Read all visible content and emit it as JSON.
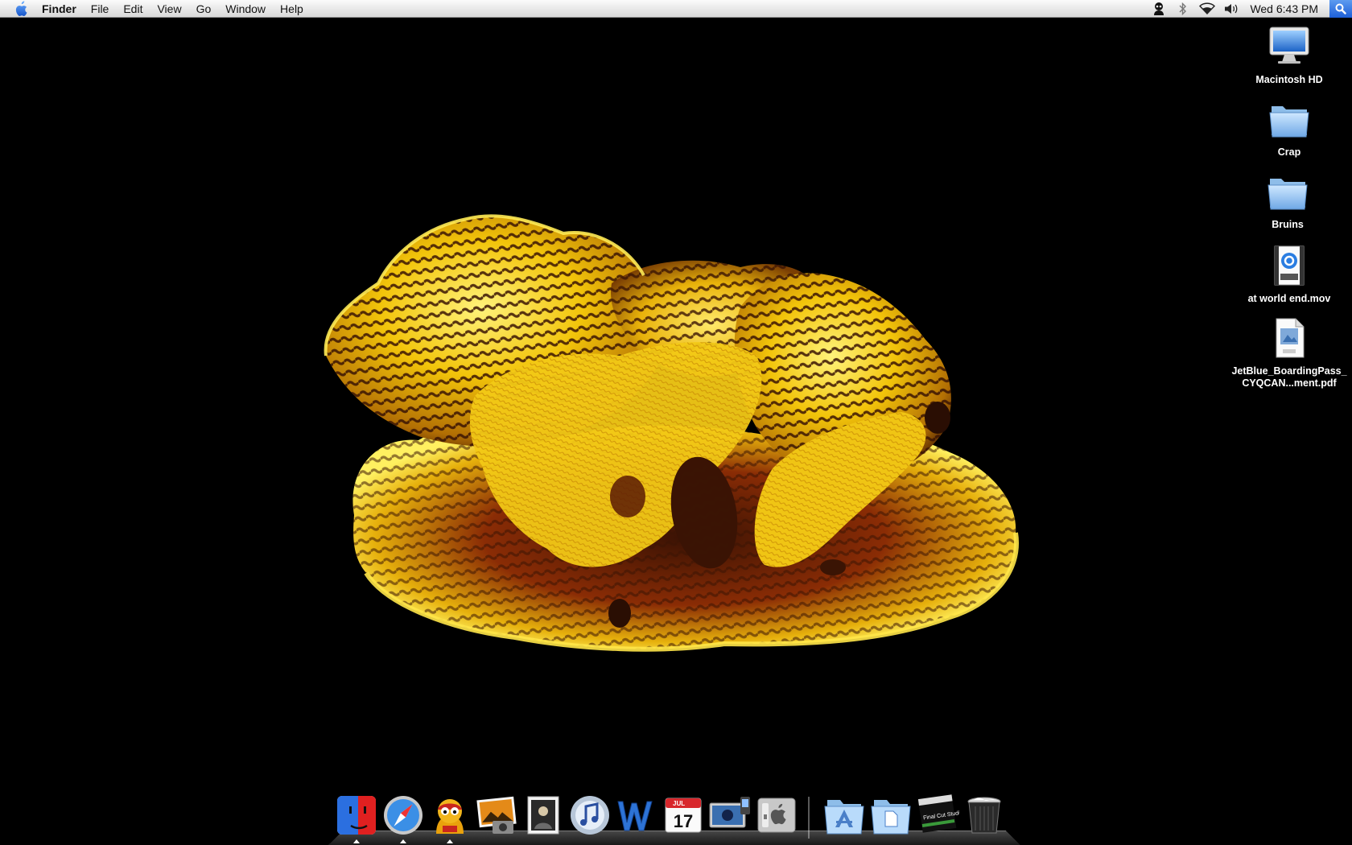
{
  "menubar": {
    "app_name": "Finder",
    "items": [
      "File",
      "Edit",
      "View",
      "Go",
      "Window",
      "Help"
    ],
    "status_icons": [
      "user-icon",
      "bluetooth-icon",
      "wifi-icon",
      "volume-icon"
    ],
    "clock": "Wed 6:43 PM"
  },
  "desktop_icons": [
    {
      "label": "Macintosh HD",
      "icon": "hard-drive-icon"
    },
    {
      "label": "Crap",
      "icon": "folder-icon"
    },
    {
      "label": "Bruins",
      "icon": "folder-icon"
    },
    {
      "label": "at world end.mov",
      "icon": "quicktime-movie-icon"
    },
    {
      "label": "JetBlue_BoardingPass_CYQCAN...ment.pdf",
      "icon": "pdf-document-icon"
    }
  ],
  "dock": {
    "apps": [
      {
        "name": "Finder",
        "icon": "finder-icon",
        "running": true
      },
      {
        "name": "Safari",
        "icon": "safari-icon",
        "running": true
      },
      {
        "name": "Adium",
        "icon": "adium-icon",
        "running": true
      },
      {
        "name": "iPhoto",
        "icon": "iphoto-icon",
        "running": false
      },
      {
        "name": "Preview",
        "icon": "preview-icon",
        "running": false
      },
      {
        "name": "iTunes",
        "icon": "itunes-icon",
        "running": false
      },
      {
        "name": "Word",
        "icon": "word-icon",
        "running": false
      },
      {
        "name": "iCal",
        "icon": "ical-icon",
        "running": false,
        "badge": "17",
        "month": "JUL"
      },
      {
        "name": "iSync",
        "icon": "isync-icon",
        "running": false
      },
      {
        "name": "System Preferences",
        "icon": "system-preferences-icon",
        "running": false
      }
    ],
    "stacks": [
      {
        "name": "Applications",
        "icon": "applications-folder-icon"
      },
      {
        "name": "Documents",
        "icon": "documents-folder-icon"
      },
      {
        "name": "Final Cut Studio",
        "icon": "final-cut-studio-icon",
        "label": "Final Cut Studio"
      },
      {
        "name": "Trash",
        "icon": "trash-icon"
      }
    ]
  },
  "colors": {
    "glass_yellow": "#f2c40a",
    "glass_stripe": "#4a1a05",
    "desktop_bg": "#000000"
  }
}
